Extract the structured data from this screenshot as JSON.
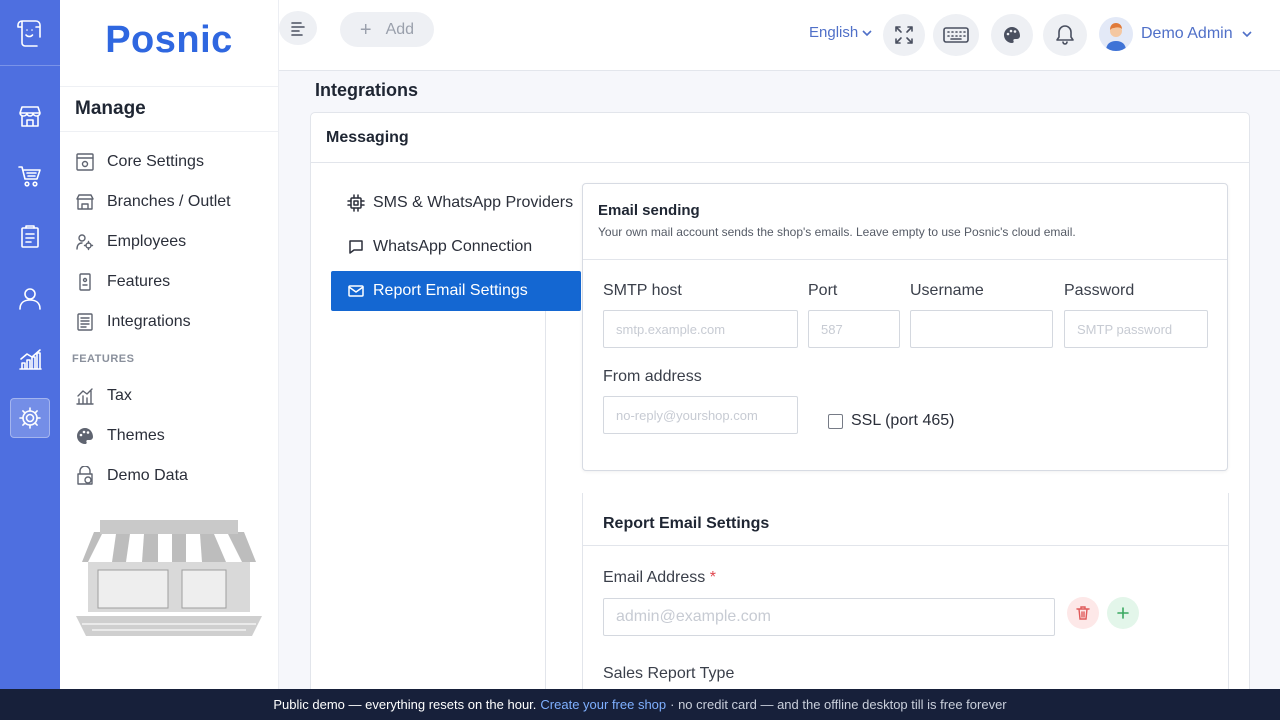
{
  "brand": {
    "name": "Posnic"
  },
  "topbar": {
    "add_label": "Add",
    "language": "English",
    "user_name": "Demo Admin"
  },
  "sidebar": {
    "section_title": "Manage",
    "items": [
      {
        "label": "Core Settings",
        "icon": "settings-window-icon"
      },
      {
        "label": "Branches / Outlet",
        "icon": "store-icon"
      },
      {
        "label": "Employees",
        "icon": "employees-icon"
      },
      {
        "label": "Features",
        "icon": "feature-icon"
      },
      {
        "label": "Integrations",
        "icon": "list-icon"
      }
    ],
    "features_header": "FEATURES",
    "feature_items": [
      {
        "label": "Tax",
        "icon": "chart-icon"
      },
      {
        "label": "Themes",
        "icon": "palette-icon"
      },
      {
        "label": "Demo Data",
        "icon": "demo-data-icon"
      }
    ]
  },
  "page": {
    "title": "Integrations",
    "card_title": "Messaging",
    "subnav": [
      {
        "label": "SMS & WhatsApp Providers",
        "icon": "chip-icon",
        "active": false
      },
      {
        "label": "WhatsApp Connection",
        "icon": "chat-icon",
        "active": false
      },
      {
        "label": "Report Email Settings",
        "icon": "mail-icon",
        "active": true
      }
    ]
  },
  "email_sending": {
    "title": "Email sending",
    "description": "Your own mail account sends the shop's emails. Leave empty to use Posnic's cloud email.",
    "smtp_host_label": "SMTP host",
    "smtp_host_placeholder": "smtp.example.com",
    "port_label": "Port",
    "port_placeholder": "587",
    "username_label": "Username",
    "username_placeholder": "",
    "password_label": "Password",
    "password_placeholder": "SMTP password",
    "from_label": "From address",
    "from_placeholder": "no-reply@yourshop.com",
    "ssl_label": "SSL (port 465)",
    "ssl_checked": false
  },
  "report_email": {
    "title": "Report Email Settings",
    "email_label": "Email Address",
    "required_mark": "*",
    "email_placeholder": "admin@example.com",
    "sales_report_label": "Sales Report Type"
  },
  "footer": {
    "prefix": "Public demo — everything resets on the hour.",
    "cta": "Create your free shop",
    "suffix": "· no credit card — and the offline desktop till is free forever"
  },
  "colors": {
    "rail": "#4e6fe0",
    "brand": "#2f67e0",
    "active_nav": "#1467d2",
    "footer": "#17203a"
  }
}
